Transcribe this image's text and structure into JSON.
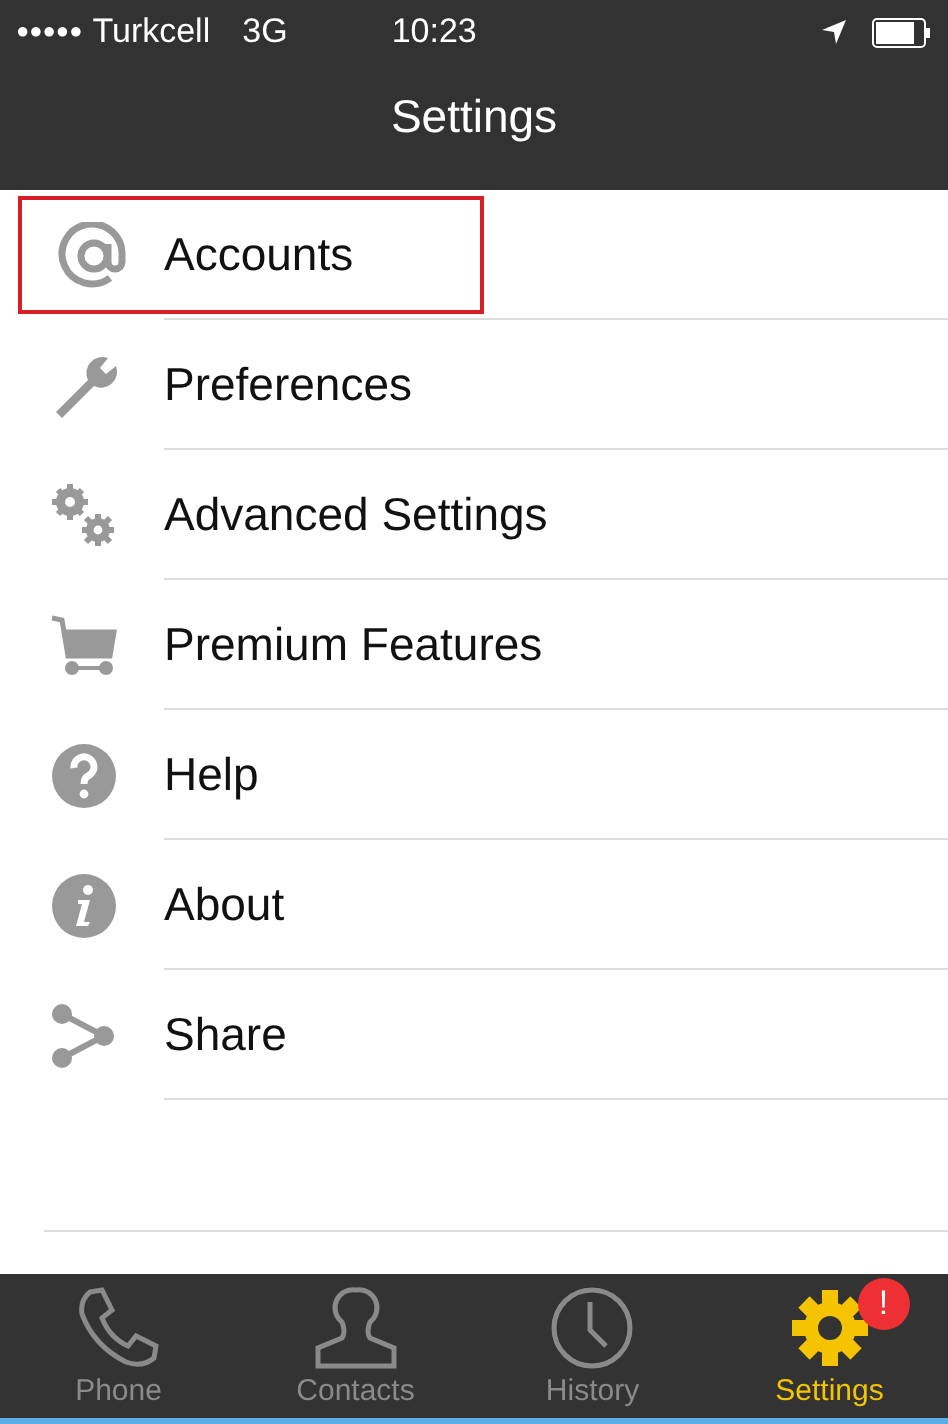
{
  "status_bar": {
    "signal_dots": "●●●●●",
    "carrier": "Turkcell",
    "network": "3G",
    "time": "10:23"
  },
  "nav_bar": {
    "title": "Settings"
  },
  "menu_items": [
    {
      "label": "Accounts",
      "highlighted": true
    },
    {
      "label": "Preferences",
      "highlighted": false
    },
    {
      "label": "Advanced Settings",
      "highlighted": false
    },
    {
      "label": "Premium Features",
      "highlighted": false
    },
    {
      "label": "Help",
      "highlighted": false
    },
    {
      "label": "About",
      "highlighted": false
    },
    {
      "label": "Share",
      "highlighted": false
    }
  ],
  "tab_bar": [
    {
      "label": "Phone",
      "selected": false
    },
    {
      "label": "Contacts",
      "selected": false
    },
    {
      "label": "History",
      "selected": false
    },
    {
      "label": "Settings",
      "selected": true,
      "badge": "!"
    }
  ]
}
